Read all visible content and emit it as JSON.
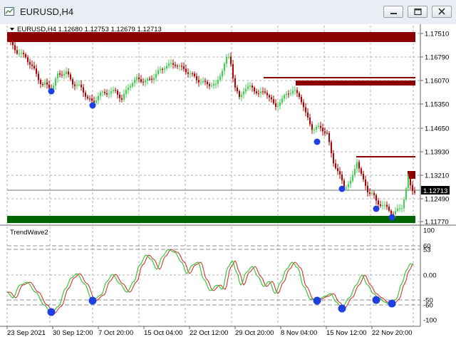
{
  "window": {
    "title": "EURUSD,H4"
  },
  "main_chart": {
    "header": "EURUSD,H4  1.12680 1.12753 1.12679 1.12713",
    "current_price": "1.12713",
    "price_labels": [
      "1.17510",
      "1.16790",
      "1.16070",
      "1.15350",
      "1.14650",
      "1.13930",
      "1.13210",
      "1.12490",
      "1.11770"
    ],
    "colors": {
      "bull": "#3fd04f",
      "bear": "#b40000",
      "zone_red": "#8b0000",
      "zone_green": "#006400",
      "marker": "#1f3fe0"
    }
  },
  "indicator": {
    "name": "TrendWave2",
    "scale_labels": [
      "100",
      "60",
      "53",
      "0.00",
      "-50",
      "-60",
      "-100"
    ]
  },
  "time_axis": {
    "labels": [
      "23 Sep 2021",
      "30 Sep 12:00",
      "7 Oct 20:00",
      "15 Oct 04:00",
      "22 Oct 12:00",
      "29 Oct 20:00",
      "8 Nov 04:00",
      "15 Nov 12:00",
      "22 Nov 20:00"
    ]
  }
}
